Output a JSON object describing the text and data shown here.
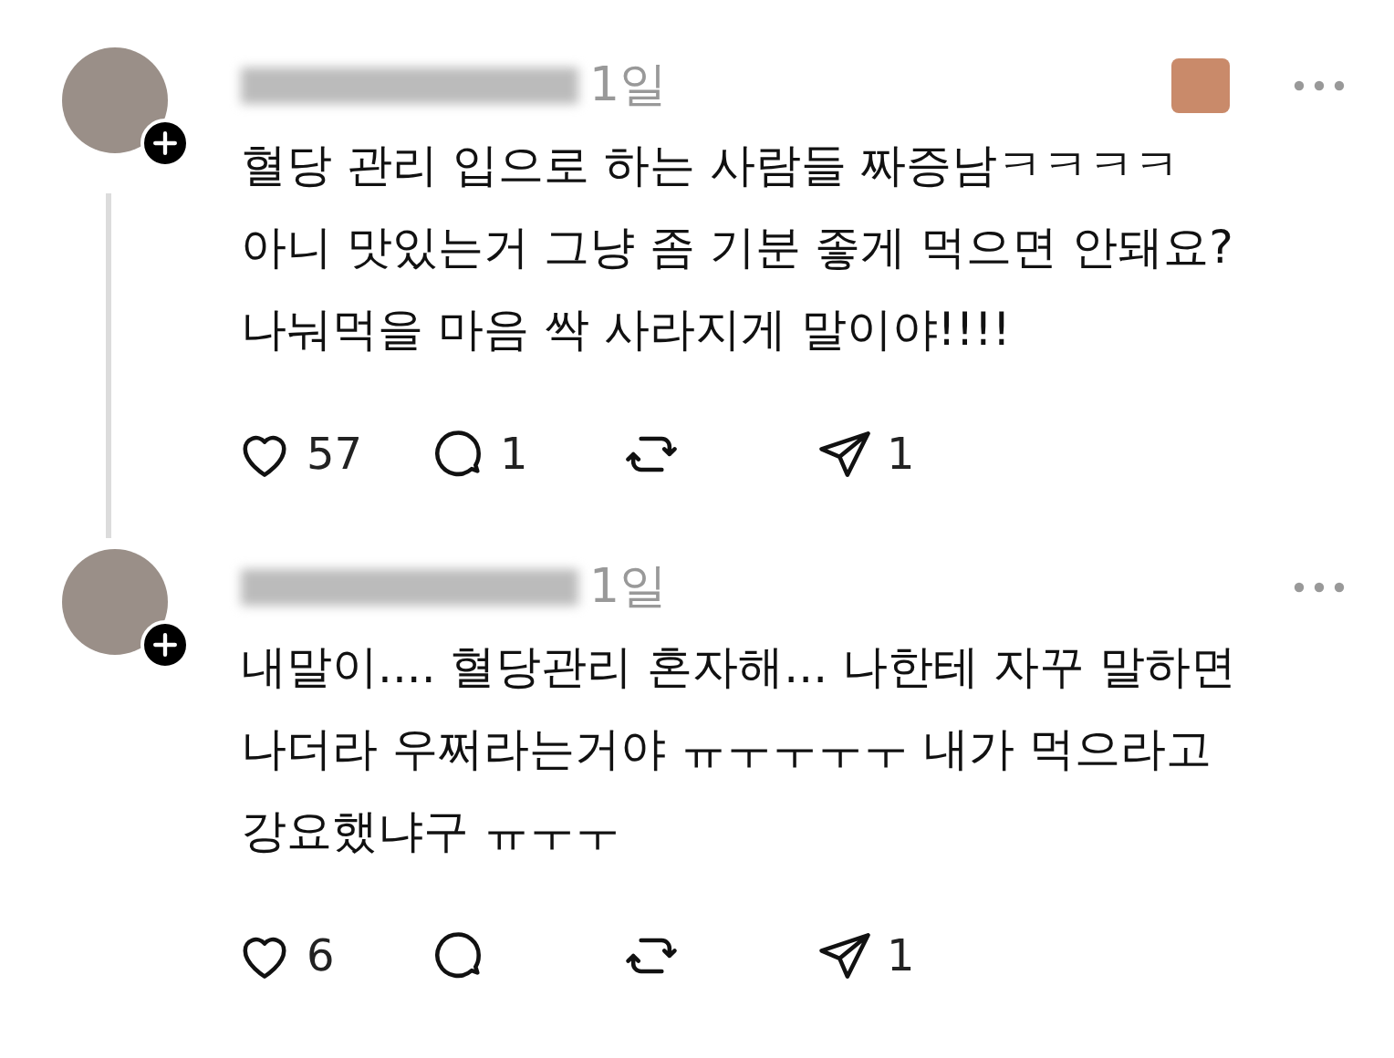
{
  "posts": [
    {
      "time": "1일",
      "thread_line": true,
      "obscured_sticker": true,
      "text": "혈당 관리 입으로 하는 사람들 짜증남ㅋㅋㅋㅋ\n아니 맛있는거 그냥 좀 기분 좋게 먹으면 안돼요?\n나눠먹을 마음 싹 사라지게 말이야!!!!",
      "actions": [
        {
          "kind": "like",
          "count": "57"
        },
        {
          "kind": "reply",
          "count": "1"
        },
        {
          "kind": "repost"
        },
        {
          "kind": "share",
          "count": "1"
        }
      ]
    },
    {
      "time": "1일",
      "thread_line": false,
      "obscured_sticker": false,
      "text": "내말이.... 혈당관리 혼자해... 나한테 자꾸 말하면\n나더라 우쩌라는거야 ㅠㅜㅜㅜㅜ 내가 먹으라고\n강요했냐구 ㅠㅜㅜ",
      "actions": [
        {
          "kind": "like",
          "count": "6"
        },
        {
          "kind": "reply"
        },
        {
          "kind": "repost"
        },
        {
          "kind": "share",
          "count": "1"
        }
      ]
    }
  ]
}
